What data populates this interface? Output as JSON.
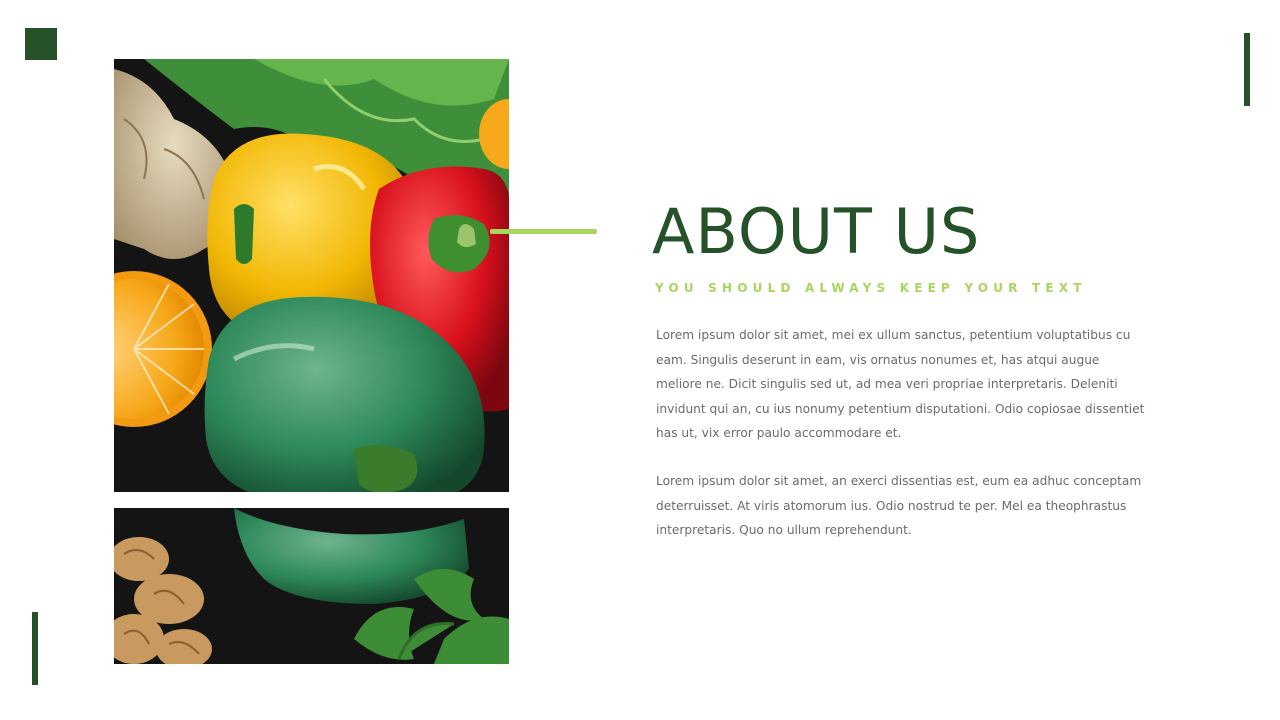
{
  "slide": {
    "title": "ABOUT US",
    "subtitle": "YOU SHOULD ALWAYS KEEP YOUR TEXT",
    "paragraphs": [
      "Lorem ipsum dolor sit amet, mei ex ullum sanctus, petentium voluptatibus cu eam. Singulis deserunt in eam, vis ornatus nonumes et, has atqui augue meliore ne. Dicit singulis sed ut, ad mea veri propriae interpretaris. Deleniti invidunt qui an, cu ius nonumy petentium disputationi. Odio copiosae dissentiet has ut, vix error paulo accommodare et.",
      "Lorem ipsum dolor sit amet, an exerci dissentias est, eum ea adhuc conceptam deterruisset. At viris atomorum ius. Odio nostrud te per. Mel ea theophrastus interpretaris. Quo no ullum reprehendunt."
    ]
  },
  "colors": {
    "brand_dark_green": "#265229",
    "accent_lime": "#a7d65e",
    "body_text": "#6b6b6b",
    "background": "#ffffff"
  },
  "decor": {
    "photo_subject": "vegetables-photo"
  }
}
